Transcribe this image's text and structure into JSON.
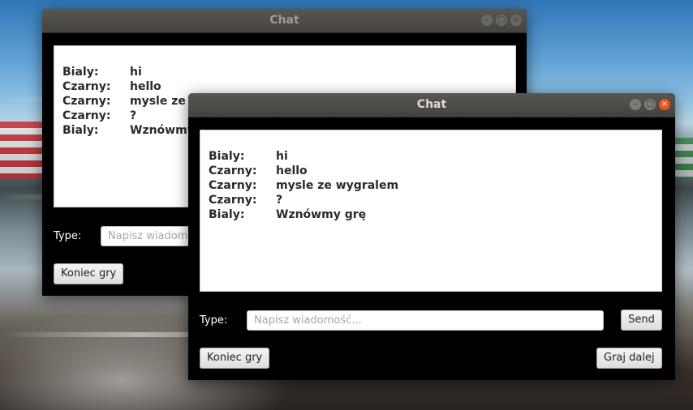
{
  "window_back": {
    "title": "Chat",
    "messages": [
      {
        "sender": "Bialy:",
        "text": "hi"
      },
      {
        "sender": "Czarny:",
        "text": "hello"
      },
      {
        "sender": "Czarny:",
        "text": "mysle ze"
      },
      {
        "sender": "Czarny:",
        "text": "?"
      },
      {
        "sender": "Bialy:",
        "text": "Wznówmy"
      }
    ],
    "type_label": "Type:",
    "input_placeholder": "Napisz wiadom",
    "end_button": "Koniec gry"
  },
  "window_front": {
    "title": "Chat",
    "messages": [
      {
        "sender": "Bialy:",
        "text": "hi"
      },
      {
        "sender": "Czarny:",
        "text": "hello"
      },
      {
        "sender": "Czarny:",
        "text": "mysle ze wygralem"
      },
      {
        "sender": "Czarny:",
        "text": "?"
      },
      {
        "sender": "Bialy:",
        "text": "Wznówmy grę"
      }
    ],
    "type_label": "Type:",
    "input_placeholder": "Napisz wiadomość...",
    "send_button": "Send",
    "end_button": "Koniec gry",
    "continue_button": "Graj dalej"
  },
  "icons": {
    "minimize": "minimize-icon",
    "maximize": "maximize-icon",
    "close": "close-icon"
  },
  "colors": {
    "accent_close": "#e95420",
    "titlebar": "#4e4c47",
    "window_bg": "#000000"
  }
}
